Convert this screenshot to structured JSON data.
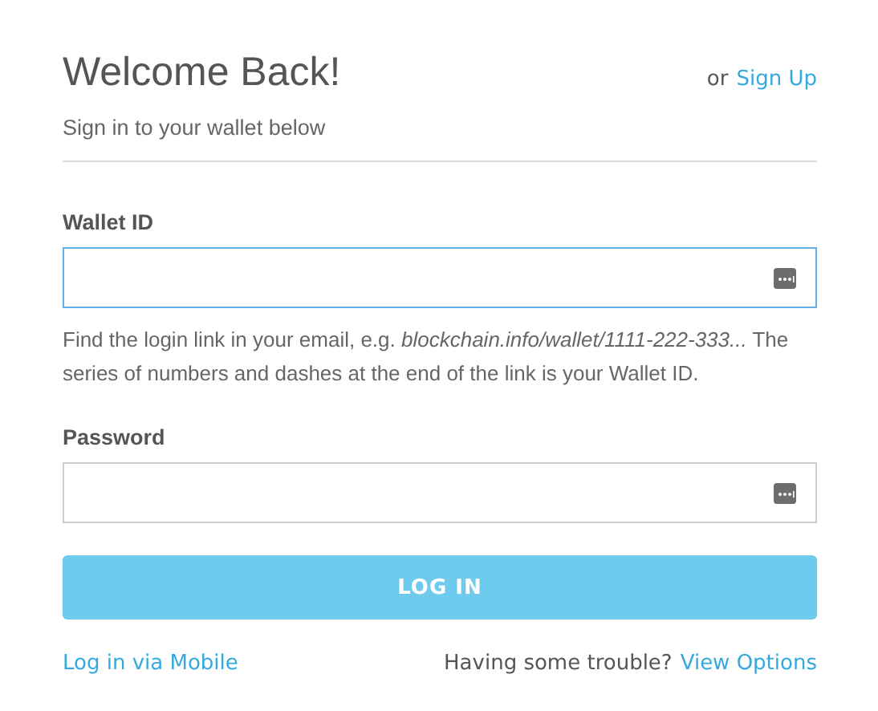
{
  "header": {
    "title": "Welcome Back!",
    "alt_prefix": "or",
    "alt_link": "Sign Up",
    "subtitle": "Sign in to your wallet below"
  },
  "fields": [
    {
      "label": "Wallet ID",
      "focused": true,
      "help": "Find the login link in your email, e.g. *blockchain.info/wallet/1111-222-333...* The series of numbers and dashes at the end of the link is your Wallet ID."
    },
    {
      "label": "Password",
      "focused": false
    }
  ],
  "submit": "LOG IN",
  "footer": {
    "mobile_link": "Log in via Mobile",
    "trouble_text": "Having some trouble?",
    "trouble_link": "View Options"
  }
}
